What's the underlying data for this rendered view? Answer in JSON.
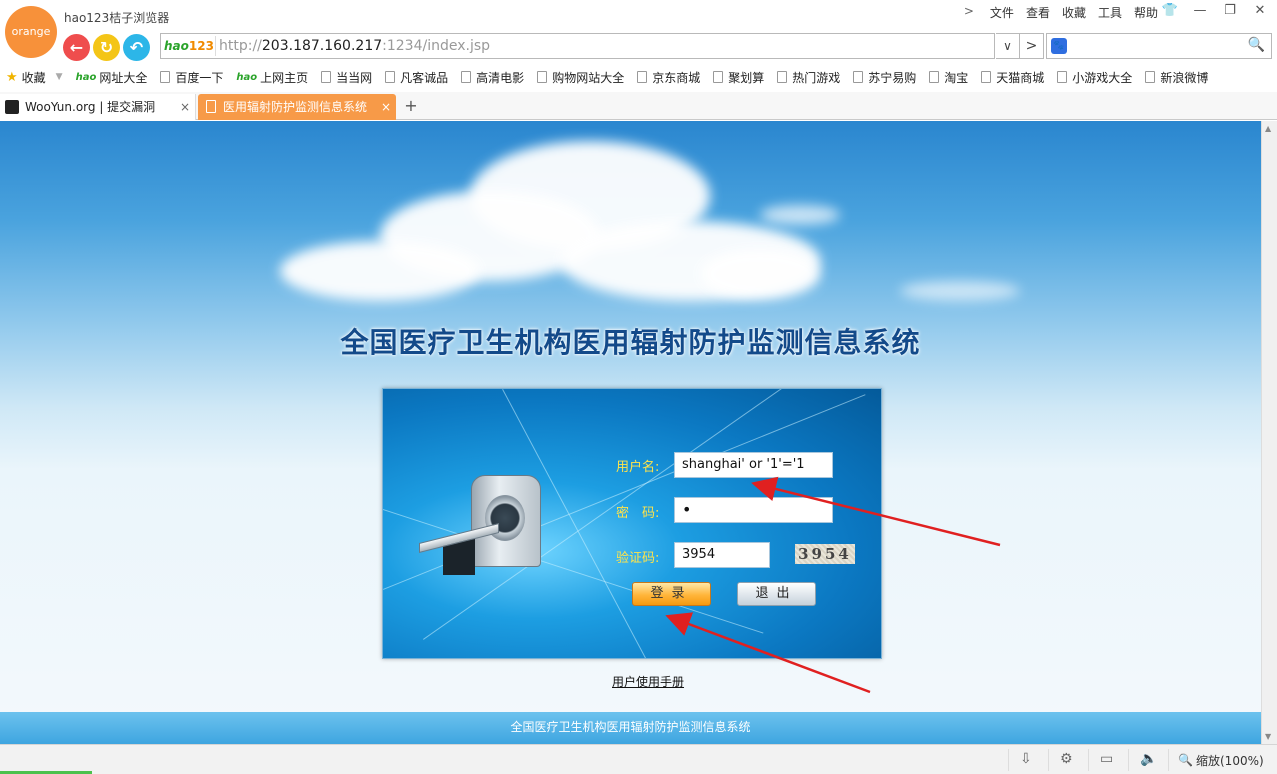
{
  "browser": {
    "logo_text": "orange",
    "app_title": "hao123桔子浏览器",
    "menu": {
      "chevron": ">",
      "items": [
        "文件",
        "查看",
        "收藏",
        "工具",
        "帮助"
      ]
    },
    "window_controls": {
      "skin": "👕",
      "minimize": "—",
      "restore": "❐",
      "close": "✕"
    },
    "nav": {
      "back": "←",
      "refresh": "↻",
      "home": "↶"
    },
    "address": {
      "badge_hao": "hao",
      "badge_num": "123",
      "url_prefix": "http://",
      "url_host": "203.187.160.217",
      "url_rest": ":1234/index.jsp",
      "dropdown": "∨",
      "go": ">"
    },
    "search": {
      "engine": "🐾",
      "icon": "🔍"
    },
    "bookmarks": [
      {
        "label": "收藏",
        "kind": "star"
      },
      {
        "label": "网址大全",
        "kind": "hao"
      },
      {
        "label": "百度一下",
        "kind": "page"
      },
      {
        "label": "上网主页",
        "kind": "hao"
      },
      {
        "label": "当当网",
        "kind": "page"
      },
      {
        "label": "凡客诚品",
        "kind": "page"
      },
      {
        "label": "高清电影",
        "kind": "page"
      },
      {
        "label": "购物网站大全",
        "kind": "page"
      },
      {
        "label": "京东商城",
        "kind": "page"
      },
      {
        "label": "聚划算",
        "kind": "page"
      },
      {
        "label": "热门游戏",
        "kind": "page"
      },
      {
        "label": "苏宁易购",
        "kind": "page"
      },
      {
        "label": "淘宝",
        "kind": "page"
      },
      {
        "label": "天猫商城",
        "kind": "page"
      },
      {
        "label": "小游戏大全",
        "kind": "page"
      },
      {
        "label": "新浪微博",
        "kind": "page"
      }
    ],
    "tabs": [
      {
        "label": "WooYun.org | 提交漏洞",
        "close": "×",
        "active": false
      },
      {
        "label": "医用辐射防护监测信息系统",
        "close": "×",
        "active": true
      }
    ],
    "new_tab": "+"
  },
  "page": {
    "system_title": "全国医疗卫生机构医用辐射防护监测信息系统",
    "form": {
      "username_label": "用户名:",
      "username_value": "shanghai' or '1'='1",
      "password_label": "密　码:",
      "password_value": "•",
      "captcha_label": "验证码:",
      "captcha_value": "3954",
      "captcha_image_text": "3954",
      "login_button": "登录",
      "exit_button": "退出"
    },
    "manual_link": "用户使用手册",
    "footer": "全国医疗卫生机构医用辐射防护监测信息系统"
  },
  "statusbar": {
    "download": "⇩",
    "settings": "⚙",
    "screen": "▭",
    "sound": "🔈",
    "zoom_icon": "🔍",
    "zoom_label": "缩放(100%)"
  },
  "colors": {
    "accent_orange": "#f79a48",
    "panel_blue": "#0b78c2",
    "label_yellow": "#ffe34a",
    "annotation_red": "#e02020"
  }
}
